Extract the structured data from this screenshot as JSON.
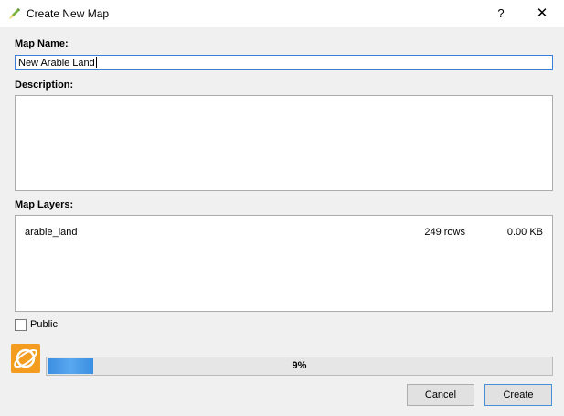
{
  "window": {
    "title": "Create New Map",
    "help_label": "?",
    "close_label": "✕"
  },
  "form": {
    "map_name_label": "Map Name:",
    "map_name_value": "New Arable Land",
    "description_label": "Description:",
    "description_value": "",
    "map_layers_label": "Map Layers:",
    "layers": [
      {
        "name": "arable_land",
        "rows": "249 rows",
        "size": "0.00 KB"
      }
    ],
    "public_label": "Public",
    "public_checked": false
  },
  "progress": {
    "value_percent": 9,
    "label": "9%"
  },
  "buttons": {
    "cancel_label": "Cancel",
    "create_label": "Create"
  },
  "icons": {
    "app": "qgis-pencil-icon",
    "plugin": "planet-logo-icon"
  },
  "colors": {
    "input_focus_border": "#3c7fd9",
    "progress_fill": "#3b8ee0",
    "plugin_icon_bg": "#f39c1f"
  }
}
